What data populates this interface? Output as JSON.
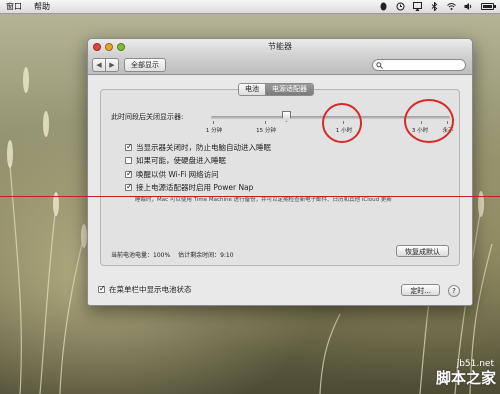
{
  "menubar": {
    "items": [
      "窗口",
      "帮助"
    ]
  },
  "window": {
    "title": "节能器",
    "toolbar": {
      "show_all": "全部显示",
      "search_placeholder": ""
    },
    "tabs": [
      {
        "label": "电池",
        "active": false
      },
      {
        "label": "电源适配器",
        "active": true
      }
    ],
    "slider": {
      "label": "此时间段后关闭显示器:",
      "value_label": "1 小时",
      "ticks": [
        "1 分钟",
        "15 分钟",
        "1 小时",
        "3 小时",
        "永不"
      ]
    },
    "checkboxes": [
      {
        "label": "当显示器关闭时，防止电脑自动进入睡眠",
        "checked": true
      },
      {
        "label": "如果可能，使硬盘进入睡眠",
        "checked": false
      },
      {
        "label": "唤醒以供 Wi-Fi 网络访问",
        "checked": true
      },
      {
        "label": "接上电源适配器时启用 Power Nap",
        "checked": true
      }
    ],
    "power_nap_note": "睡眠时，Mac 可以使用 Time Machine 进行备份，并可以定期检查新电子邮件、日历和其他 iCloud 更新",
    "status": {
      "battery": "当前电池电量：100%",
      "estimate": "估计剩余时间：9:10"
    },
    "restore_defaults": "恢复成默认",
    "menubar_checkbox": {
      "label": "在菜单栏中显示电池状态",
      "checked": true
    },
    "schedule_button": "定时...",
    "help": "?"
  },
  "watermark": {
    "site": "jb51.net",
    "name": "脚本之家"
  },
  "colors": {
    "annotation_red": "#d42b2b",
    "tab_active": "#8a8a8a"
  },
  "battery_level": 1.0
}
